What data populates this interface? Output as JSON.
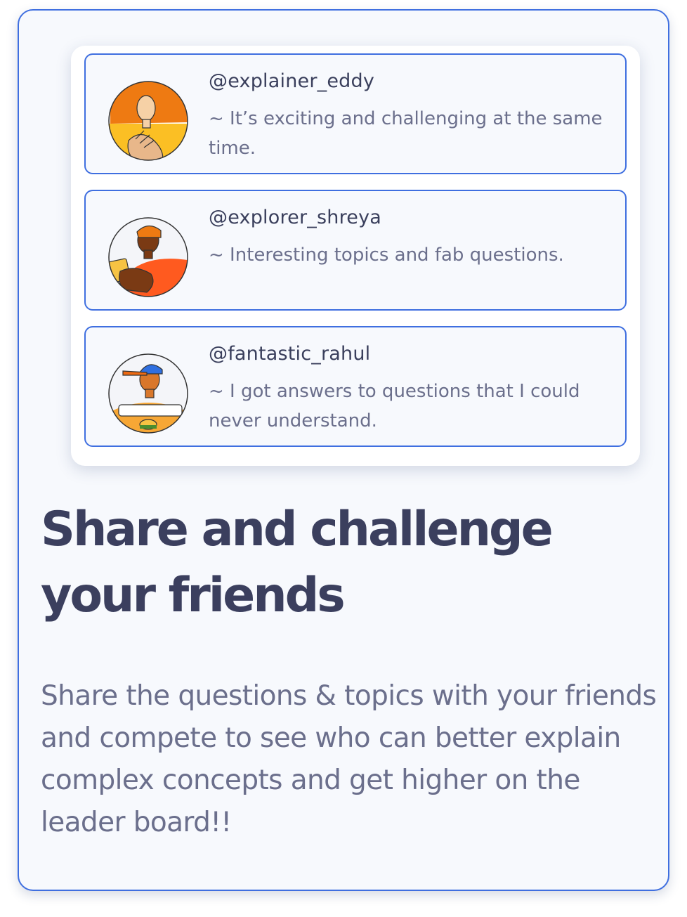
{
  "reviews": [
    {
      "handle": "@explainer_eddy",
      "quote": "~ It’s exciting and challenging at the same time.",
      "avatar": "woman-orange-hair-avatar"
    },
    {
      "handle": "@explorer_shreya",
      "quote": "~ Interesting topics and fab questions.",
      "avatar": "person-waving-avatar"
    },
    {
      "handle": "@fantastic_rahul",
      "quote": "~ I got answers to questions that I could never understand.",
      "avatar": "man-with-cap-burger-avatar"
    }
  ],
  "headline": "Share and challenge your friends",
  "description": "Share the questions & topics with your friends and compete to see who can better explain complex concepts and get higher on the leader board!!",
  "colors": {
    "accent": "#3f6fe0",
    "heading": "#3b3f5e",
    "body": "#6b6f8c",
    "card_bg": "#f7f9fd"
  }
}
